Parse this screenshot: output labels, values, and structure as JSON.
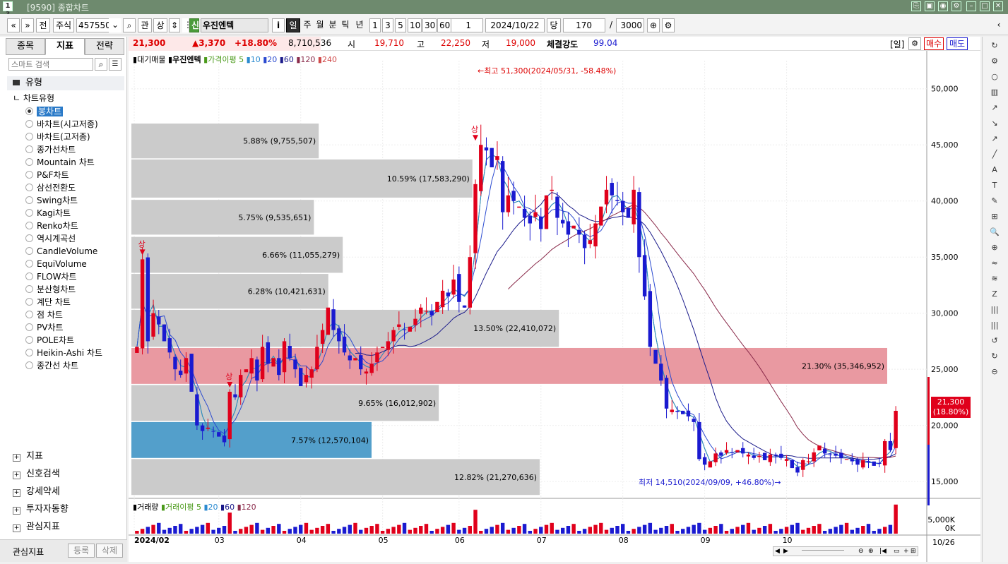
{
  "titlebar": {
    "title": "[9590] 종합차트",
    "badge": "1 ?"
  },
  "toolbar": {
    "prev": "«",
    "down": "»",
    "jeon": "전",
    "market": "주식",
    "code": "457550",
    "search_icon": "search-icon",
    "gwan": "관",
    "sang": "상",
    "sin": "신",
    "name": "우진엔텍",
    "info": "i",
    "periods": [
      "일",
      "주",
      "월",
      "분",
      "틱",
      "년"
    ],
    "mins": [
      "1",
      "3",
      "5",
      "10",
      "30",
      "60"
    ],
    "unit": "1",
    "date": "2024/10/22",
    "dang": "당",
    "count": "170",
    "slash": "/",
    "total": "3000"
  },
  "left": {
    "tabs": [
      "종목",
      "지표",
      "전략"
    ],
    "search_placeholder": "스마트 검색",
    "type_label": "유형",
    "chart_type_label": "차트유형",
    "chart_types": [
      "봉차트",
      "바차트(시고저종)",
      "바차트(고저종)",
      "종가선차트",
      "Mountain 차트",
      "P&F차트",
      "삼선전환도",
      "Swing차트",
      "Kagi차트",
      "Renko차트",
      "역시계곡선",
      "CandleVolume",
      "EquiVolume",
      "FLOW차트",
      "분산형차트",
      "계단 차트",
      "점 차트",
      "PV차트",
      "POLE차트",
      "Heikin-Ashi 차트",
      "종간선 차트"
    ],
    "groups": [
      "지표",
      "신호검색",
      "강세약세",
      "투자자동향",
      "관심지표"
    ],
    "footer_label": "관심지표",
    "register": "등록",
    "delete": "삭제"
  },
  "quote": {
    "price": "21,300",
    "change": "▲3,370",
    "rate": "+18.80%",
    "volume": "8,710,536",
    "open_label": "시",
    "open": "19,710",
    "high_label": "고",
    "high": "22,250",
    "low_label": "저",
    "low": "19,000",
    "strength_label": "체결강도",
    "strength": "99.04",
    "period_tag": "[일]",
    "buy": "매수",
    "sell": "매도"
  },
  "legend": {
    "main": "대기매물",
    "name": "우진엔텍",
    "ma_label": "가격이평",
    "ma": [
      "5",
      "10",
      "20",
      "60",
      "120",
      "240"
    ],
    "vol_label": "거래량",
    "vol_ma_label": "거래이평",
    "vol_ma": [
      "5",
      "20",
      "60",
      "120"
    ]
  },
  "annotations": {
    "high": "←최고 51,300(2024/05/31, -58.48%)",
    "low": "최저 14,510(2024/09/09, +46.80%)→",
    "sang": "상",
    "current": "21,300",
    "current_rate": "(18.80%)"
  },
  "colors": {
    "up": "#e0001b",
    "down": "#1a1ad0",
    "box": "#c8c8c8",
    "box_hi": "#e8949c",
    "box_lo": "#4a9ac8"
  },
  "chart_data": {
    "type": "candlestick",
    "yticks": [
      50000,
      45000,
      40000,
      35000,
      30000,
      25000,
      20000,
      15000
    ],
    "ylim": [
      13500,
      52500
    ],
    "vol_ticks": [
      "5,000K",
      "0K"
    ],
    "xlabels": [
      "2024/02",
      "03",
      "04",
      "05",
      "06",
      "07",
      "08",
      "09",
      "10"
    ],
    "last_date": "10/26",
    "volume_profile": [
      {
        "range": [
          43800,
          46900
        ],
        "pct": "5.88%",
        "vol": "9,755,507",
        "frac": 0.39
      },
      {
        "range": [
          40300,
          43700
        ],
        "pct": "10.59%",
        "vol": "17,583,290",
        "frac": 0.71
      },
      {
        "range": [
          37000,
          40100
        ],
        "pct": "5.75%",
        "vol": "9,535,651",
        "frac": 0.38
      },
      {
        "range": [
          33600,
          36800
        ],
        "pct": "6.66%",
        "vol": "11,055,279",
        "frac": 0.44
      },
      {
        "range": [
          30400,
          33500
        ],
        "pct": "6.28%",
        "vol": "10,421,631",
        "frac": 0.41
      },
      {
        "range": [
          27000,
          30300
        ],
        "pct": "13.50%",
        "vol": "22,410,072",
        "frac": 0.89
      },
      {
        "range": [
          23700,
          26900
        ],
        "pct": "21.30%",
        "vol": "35,346,952",
        "frac": 1.0,
        "hi": true
      },
      {
        "range": [
          20400,
          23600
        ],
        "pct": "9.65%",
        "vol": "16,012,902",
        "frac": 0.64
      },
      {
        "range": [
          17100,
          20300
        ],
        "pct": "7.57%",
        "vol": "12,570,104",
        "frac": 0.5,
        "lo": true
      },
      {
        "range": [
          13800,
          17000
        ],
        "pct": "12.82%",
        "vol": "21,270,636",
        "frac": 0.85
      }
    ],
    "closes": [
      27000,
      34800,
      27500,
      30000,
      29000,
      27500,
      26500,
      25000,
      24500,
      26000,
      23000,
      20000,
      19500,
      19800,
      19500,
      19000,
      18500,
      23000,
      22500,
      24500,
      25000,
      26000,
      24000,
      27000,
      25500,
      26000,
      24500,
      27500,
      26000,
      25000,
      23500,
      24500,
      25000,
      27000,
      28500,
      30500,
      28500,
      27500,
      26500,
      25800,
      26000,
      25000,
      24800,
      25500,
      26500,
      27000,
      27500,
      28500,
      29000,
      28500,
      28800,
      29500,
      30500,
      30200,
      29800,
      31000,
      32000,
      31500,
      33000,
      31000,
      30500,
      35000,
      41500,
      45000,
      44500,
      43000,
      44000,
      39000,
      40500,
      40000,
      39500,
      38500,
      38000,
      39000,
      37500,
      40500,
      41000,
      38500,
      38000,
      37000,
      37800,
      37000,
      35800,
      36500,
      38000,
      39500,
      41000,
      40500,
      40000,
      39000,
      38500,
      41000,
      35000,
      31500,
      27000,
      25500,
      24000,
      21500,
      21400,
      21200,
      21000,
      20800,
      20300,
      17000,
      16500,
      16800,
      17500,
      17300,
      17800,
      17600,
      17800,
      17500,
      17400,
      17100,
      17300,
      16900,
      17400,
      17300,
      17100,
      17000,
      16200,
      15800,
      16900,
      16800,
      17600,
      18200,
      17500,
      17400,
      17300,
      17100,
      17000,
      16800,
      16500,
      16900,
      16700,
      16400,
      16600,
      18600,
      17800,
      21300
    ],
    "ma": [
      {
        "period": 5,
        "color": "#4a9a1a"
      },
      {
        "period": 10,
        "color": "#2a8ad0"
      },
      {
        "period": 20,
        "color": "#2a4ad0"
      },
      {
        "period": 60,
        "color": "#1a1a8a"
      },
      {
        "period": 120,
        "color": "#8a2a4a"
      }
    ]
  }
}
